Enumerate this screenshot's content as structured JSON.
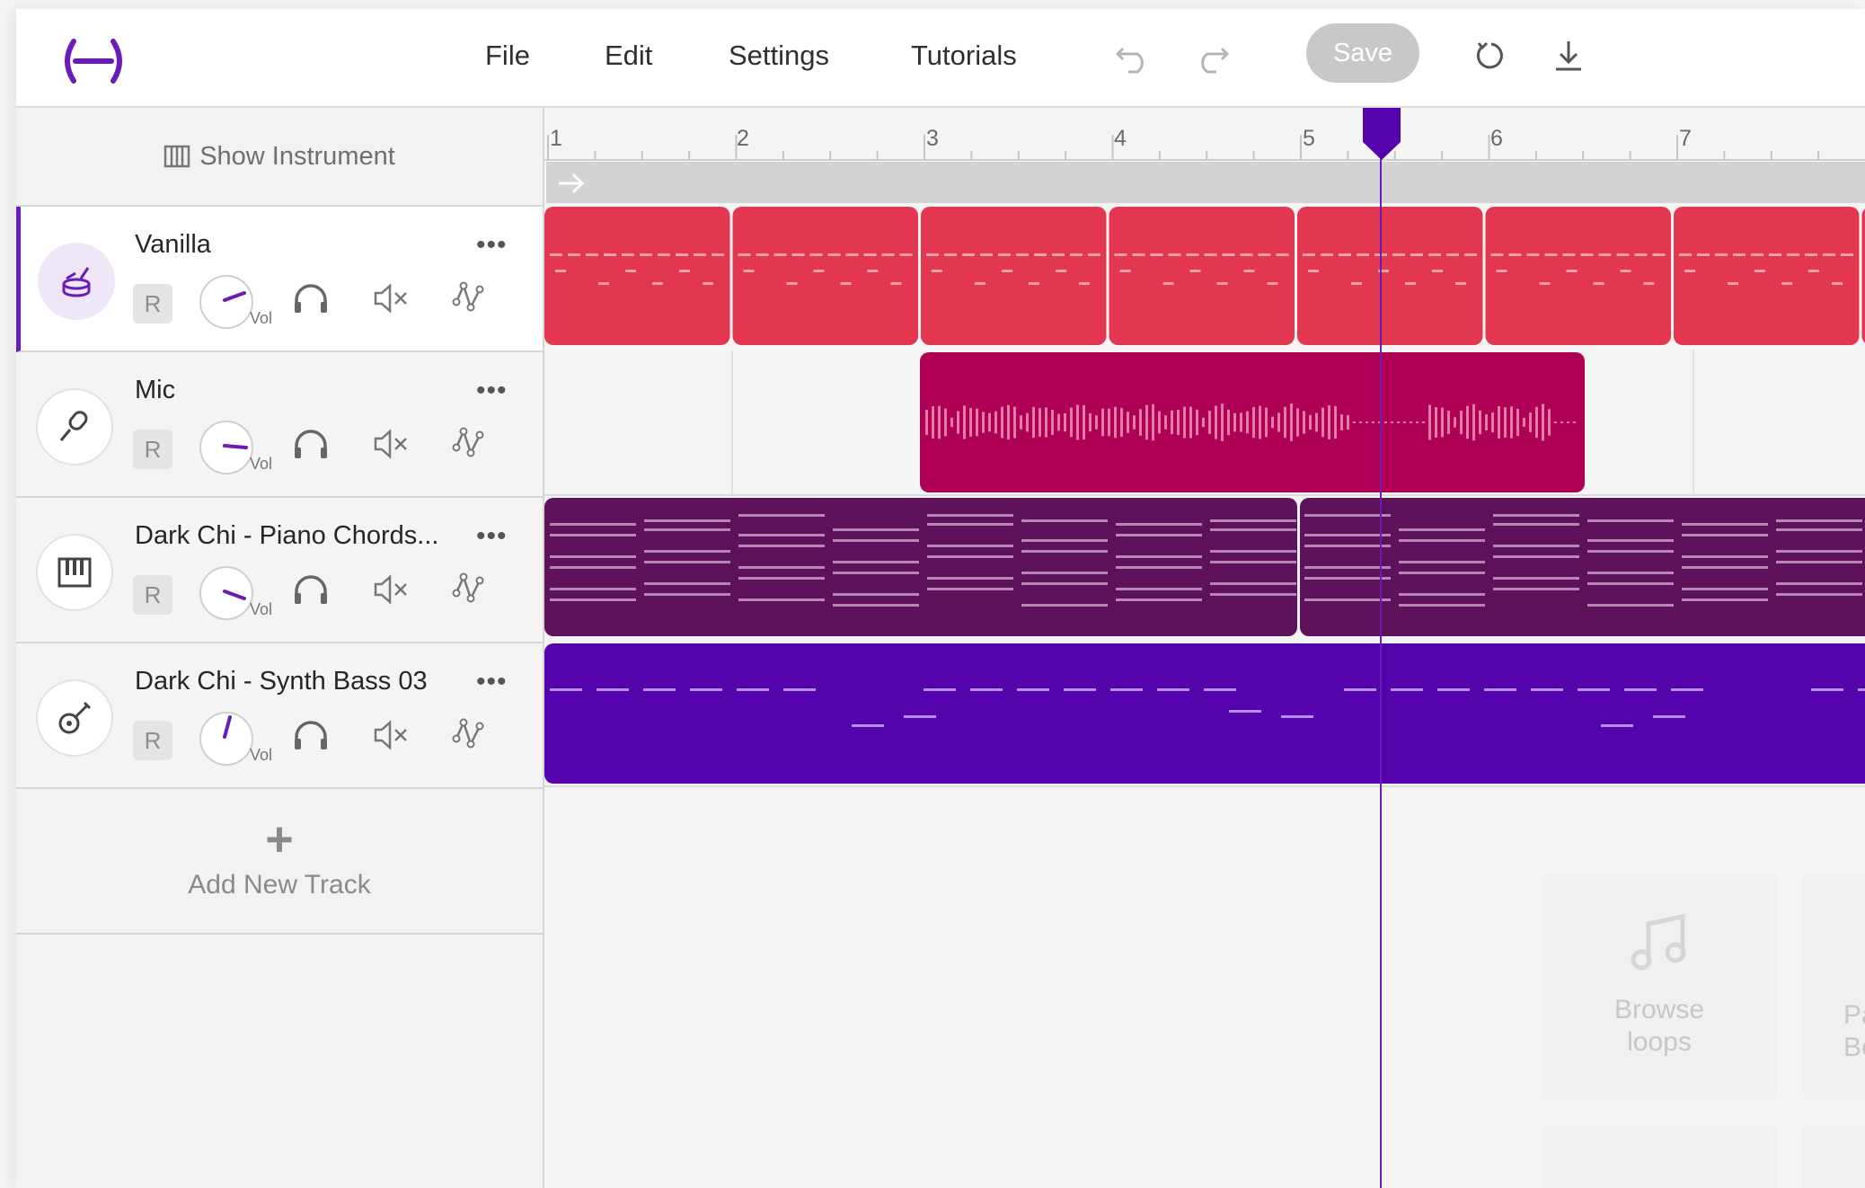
{
  "menu": {
    "file": "File",
    "edit": "Edit",
    "settings": "Settings",
    "tutorials": "Tutorials"
  },
  "toolbar": {
    "save_label": "Save"
  },
  "left_panel": {
    "show_instrument": "Show Instrument",
    "add_new_track": "Add New Track"
  },
  "tracks": [
    {
      "name": "Vanilla",
      "record": "R",
      "vol_label": "Vol",
      "icon": "drum-icon",
      "selected": true,
      "color": "#e33751"
    },
    {
      "name": "Mic",
      "record": "R",
      "vol_label": "Vol",
      "icon": "microphone-icon",
      "selected": false,
      "color": "#ae0055"
    },
    {
      "name": "Dark Chi - Piano Chords...",
      "record": "R",
      "vol_label": "Vol",
      "icon": "piano-icon",
      "selected": false,
      "color": "#5e125b"
    },
    {
      "name": "Dark Chi - Synth Bass 03",
      "record": "R",
      "vol_label": "Vol",
      "icon": "guitar-icon",
      "selected": false,
      "color": "#5503ad"
    }
  ],
  "ruler": {
    "bars": [
      "1",
      "2",
      "3",
      "4",
      "5",
      "6",
      "7"
    ]
  },
  "placeholders": {
    "browse_loops": "Browse loops",
    "partial_left": "Pa",
    "partial_left2": "Be"
  },
  "colors": {
    "accent": "#6a1bb8",
    "save_disabled": "#c8c8c8"
  }
}
